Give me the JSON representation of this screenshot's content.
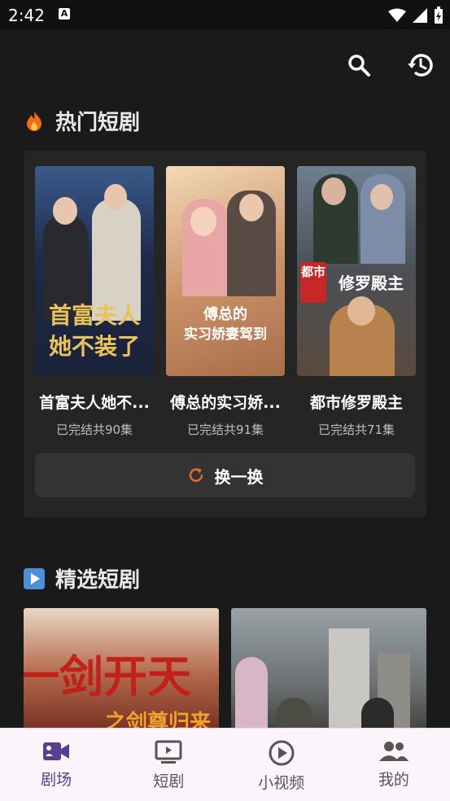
{
  "status_bar": {
    "time": "2:42",
    "notif_letter": "A"
  },
  "sections": {
    "hot": {
      "title": "热门短剧",
      "icon": "fire-icon"
    },
    "featured": {
      "title": "精选短剧",
      "icon": "play-square-icon"
    }
  },
  "hot_dramas": [
    {
      "title": "首富夫人她不...",
      "status": "已完结共90集",
      "cover_text_1": "首富夫人",
      "cover_text_2": "她不装了"
    },
    {
      "title": "傅总的实习娇...",
      "status": "已完结共91集",
      "cover_text_1": "傅总的",
      "cover_text_2": "实习娇妻驾到"
    },
    {
      "title": "都市修罗殿主",
      "status": "已完结共71集",
      "cover_text_1": "修罗殿主",
      "cover_badge": "都市"
    }
  ],
  "refresh": {
    "label": "换一换"
  },
  "featured_items": [
    {
      "cover_text_1": "一剑开天",
      "cover_text_2": "之剑尊归来"
    },
    {
      "cover_text_1": ""
    }
  ],
  "nav": [
    {
      "label": "剧场",
      "icon": "video-camera-icon",
      "active": true
    },
    {
      "label": "短剧",
      "icon": "tv-play-icon",
      "active": false
    },
    {
      "label": "小视频",
      "icon": "play-circle-icon",
      "active": false
    },
    {
      "label": "我的",
      "icon": "people-icon",
      "active": false
    }
  ],
  "colors": {
    "accent": "#5a3f90",
    "refresh_icon": "#e86a2c",
    "background": "#1a1a1a",
    "card": "#252525"
  }
}
